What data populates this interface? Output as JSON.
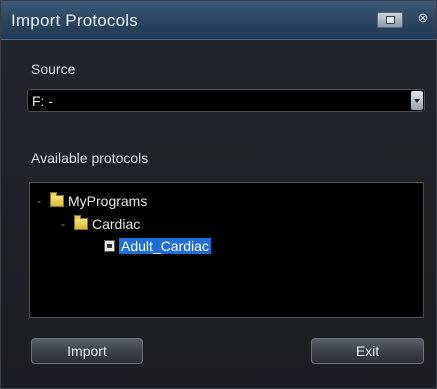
{
  "window": {
    "title": "Import Protocols"
  },
  "source": {
    "label": "Source",
    "value": "F: -"
  },
  "protocols": {
    "label": "Available protocols",
    "tree": [
      {
        "label": "MyPrograms",
        "toggle": "-",
        "icon": "folder-icon"
      },
      {
        "label": "Cardiac",
        "toggle": "-",
        "icon": "folder-icon"
      },
      {
        "label": "Adult_Cardiac",
        "icon": "protocol-file-icon",
        "selected": true
      }
    ]
  },
  "buttons": {
    "import": "Import",
    "exit": "Exit"
  },
  "colors": {
    "titlebar": "#2b4560",
    "selection": "#1f6fd6",
    "background": "#1e2126"
  }
}
